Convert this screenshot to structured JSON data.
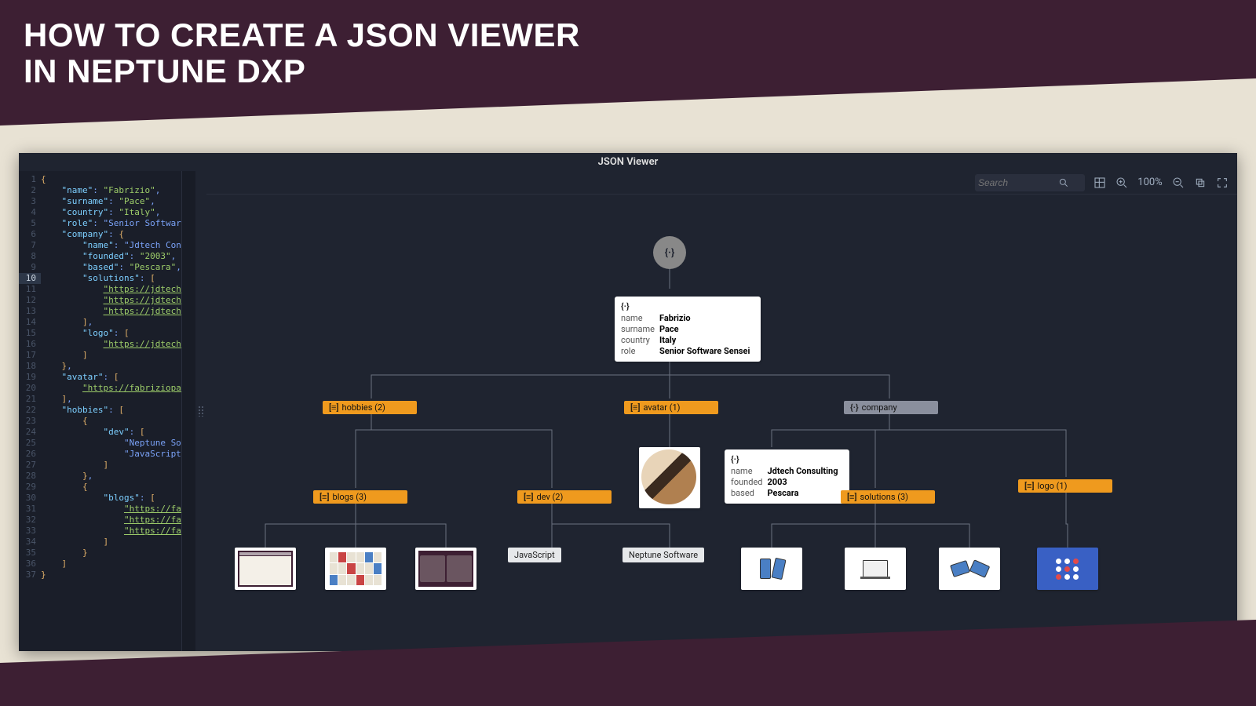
{
  "title_line1": "HOW TO CREATE A JSON VIEWER",
  "title_line2": "IN NEPTUNE DXP",
  "app_title": "JSON Viewer",
  "toolbar": {
    "search_placeholder": "Search",
    "zoom": "100%"
  },
  "code": {
    "lines": [
      "{",
      "    \"name\": \"Fabrizio\",",
      "    \"surname\": \"Pace\",",
      "    \"country\": \"Italy\",",
      "    \"role\": \"Senior Software",
      "    \"company\": {",
      "        \"name\": \"Jdtech Cons",
      "        \"founded\": \"2003\",",
      "        \"based\": \"Pescara\",",
      "        \"solutions\": [",
      "            \"https://jdtech.",
      "            \"https://jdtech.",
      "            \"https://jdtech.",
      "        ],",
      "        \"logo\": [",
      "            \"https://jdtech.",
      "        ]",
      "    },",
      "    \"avatar\": [",
      "        \"https://fabriziopac",
      "    ],",
      "    \"hobbies\": [",
      "        {",
      "            \"dev\": [",
      "                \"Neptune Sof",
      "                \"JavaScript\"",
      "            ]",
      "        },",
      "        {",
      "            \"blogs\": [",
      "                \"https://fab",
      "                \"https://fab",
      "                \"https://fab",
      "            ]",
      "        }",
      "    ]",
      "}"
    ],
    "highlight_line": 10
  },
  "diagram": {
    "root_glyph": "{·}",
    "root_card": {
      "glyph": "{·}",
      "rows": [
        [
          "name",
          "Fabrizio"
        ],
        [
          "surname",
          "Pace"
        ],
        [
          "country",
          "Italy"
        ],
        [
          "role",
          "Senior Software Sensei"
        ]
      ]
    },
    "hobbies_tag": "hobbies (2)",
    "avatar_tag": "avatar (1)",
    "company_tag": "company",
    "blogs_tag": "blogs (3)",
    "dev_tag": "dev (2)",
    "solutions_tag": "solutions (3)",
    "logo_tag": "logo (1)",
    "company_card": {
      "glyph": "{·}",
      "rows": [
        [
          "name",
          "Jdtech Consulting"
        ],
        [
          "founded",
          "2003"
        ],
        [
          "based",
          "Pescara"
        ]
      ]
    },
    "dev_label_js": "JavaScript",
    "dev_label_np": "Neptune Software",
    "array_glyph": "[≡]",
    "object_glyph": "{·}"
  }
}
